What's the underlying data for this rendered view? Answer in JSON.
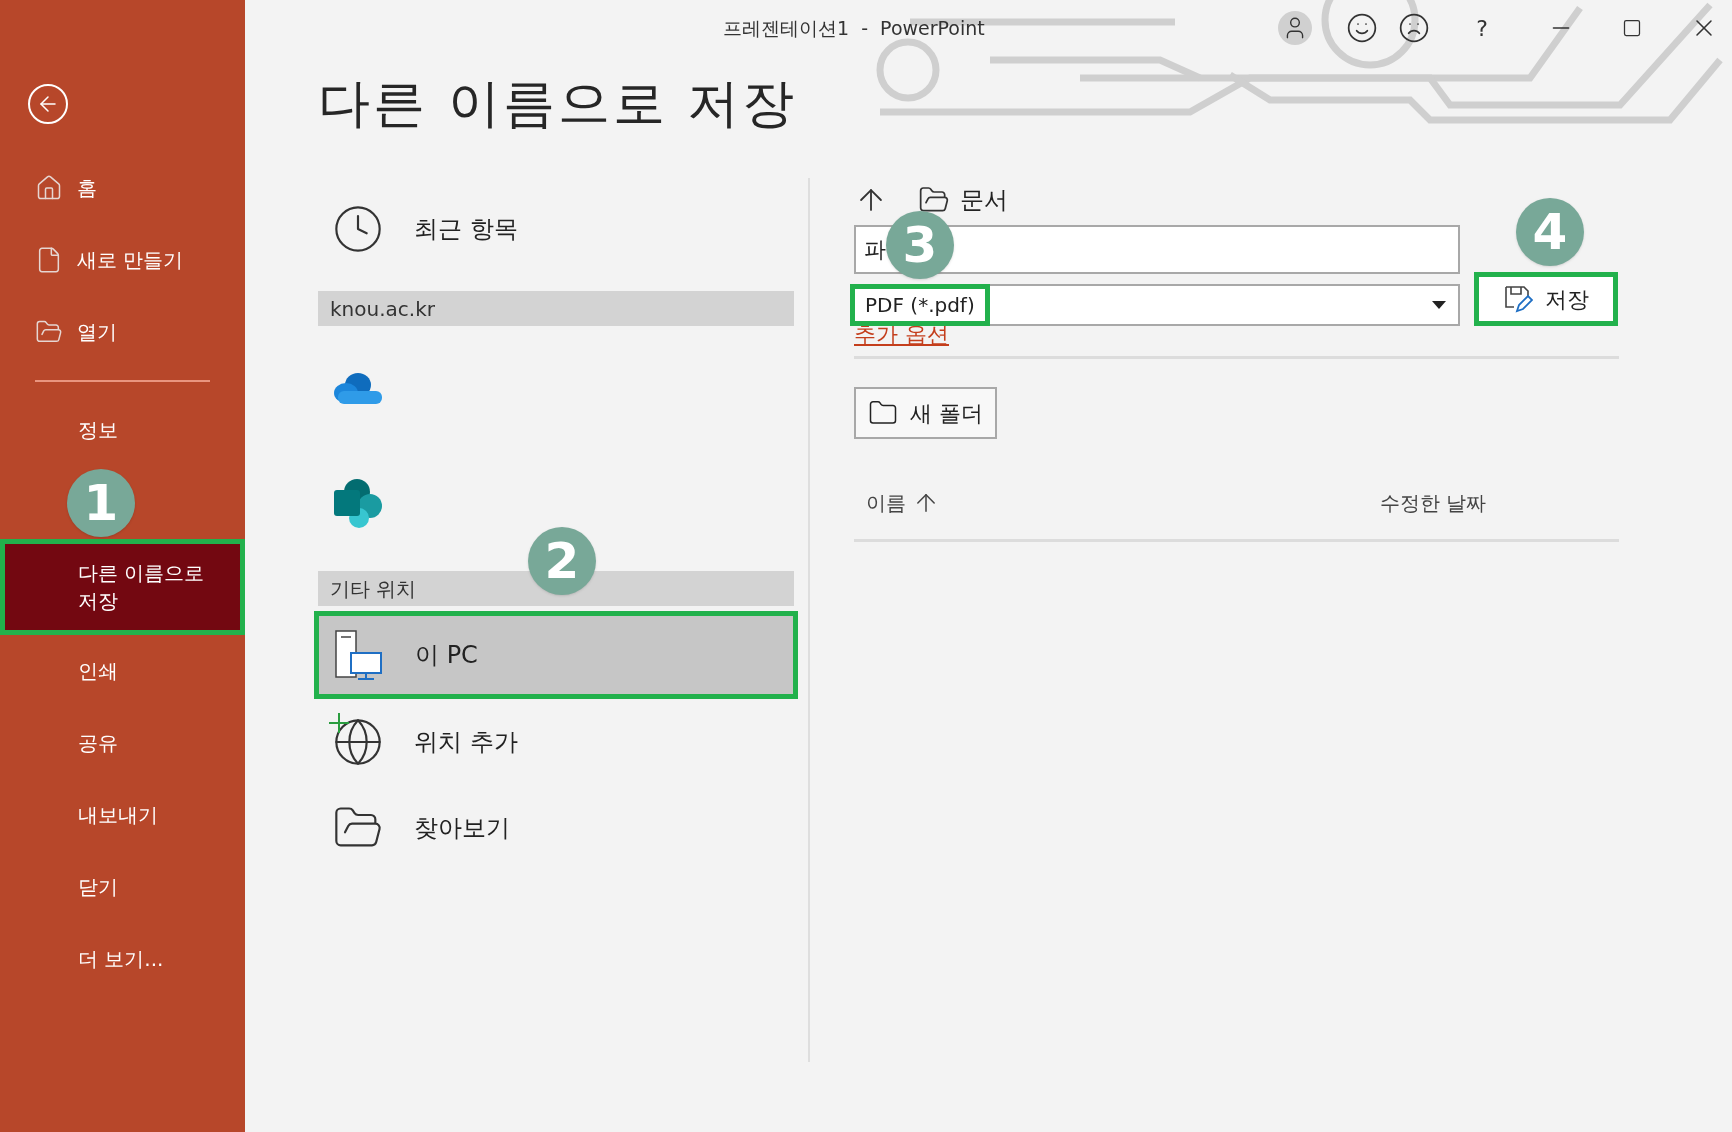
{
  "window": {
    "title": "프레젠테이션1  -  PowerPoint",
    "help": "?"
  },
  "sidebar": {
    "items": [
      {
        "label": "홈",
        "selected": false,
        "highlighted": false
      },
      {
        "label": "새로 만들기",
        "selected": false,
        "highlighted": false
      },
      {
        "label": "열기",
        "selected": false,
        "highlighted": false
      },
      {
        "label": "정보",
        "selected": false,
        "highlighted": false
      },
      {
        "label": "다른 이름으로 저장",
        "selected": true,
        "highlighted": true,
        "callout": "1"
      },
      {
        "label": "인쇄",
        "selected": false,
        "highlighted": false
      },
      {
        "label": "공유",
        "selected": false,
        "highlighted": false
      },
      {
        "label": "내보내기",
        "selected": false,
        "highlighted": false
      },
      {
        "label": "닫기",
        "selected": false,
        "highlighted": false
      },
      {
        "label": "더 보기...",
        "selected": false,
        "highlighted": false
      }
    ]
  },
  "page_title": "다른 이름으로 저장",
  "locations": [
    {
      "kind": "item",
      "label": "최근 항목",
      "selected": false,
      "highlighted": false
    },
    {
      "kind": "header",
      "label": "knou.ac.kr"
    },
    {
      "kind": "item",
      "selected": false,
      "highlighted": false
    },
    {
      "kind": "item",
      "selected": false,
      "highlighted": false
    },
    {
      "kind": "header",
      "label": "기타 위치",
      "callout": "2"
    },
    {
      "kind": "item",
      "label": "이 PC",
      "selected": true,
      "highlighted": true
    },
    {
      "kind": "item",
      "label": "위치 추가",
      "selected": false,
      "highlighted": false
    },
    {
      "kind": "item",
      "label": "찾아보기",
      "selected": false,
      "highlighted": false
    }
  ],
  "save_panel": {
    "path": "문서",
    "file_name": {
      "value": "파",
      "callout": "3"
    },
    "file_type": {
      "value": "PDF (*.pdf)",
      "highlighted": true
    },
    "more_options": "추가 옵션",
    "save_button": {
      "label": "저장",
      "highlighted": true,
      "callout": "4"
    },
    "new_folder": "새 폴더",
    "columns": [
      "이름",
      "수정한 날짜"
    ]
  }
}
